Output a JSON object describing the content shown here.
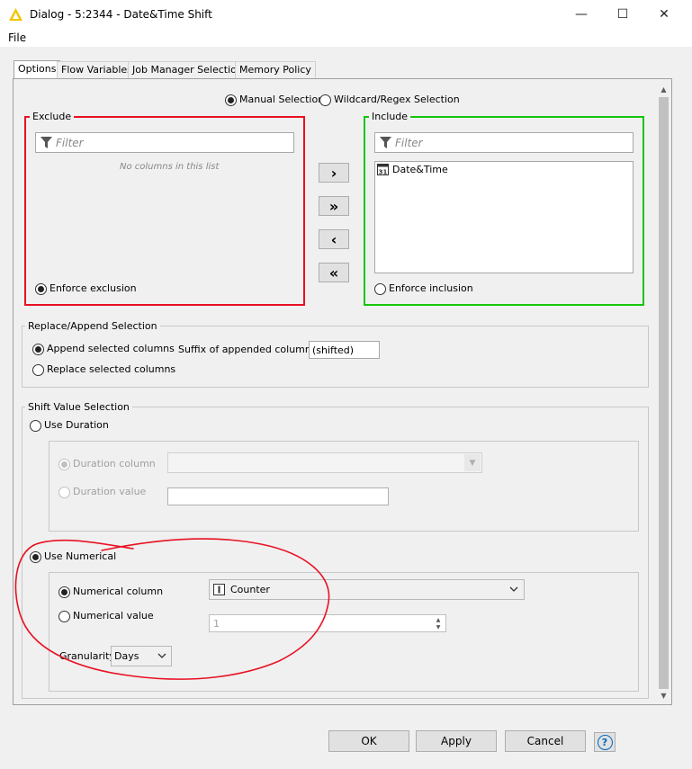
{
  "window": {
    "title": "Dialog - 5:2344 - Date&Time Shift",
    "minimize": "—",
    "maximize": "☐",
    "close": "✕"
  },
  "menu": {
    "file": "File"
  },
  "tabs": [
    "Options",
    "Flow Variables",
    "Job Manager Selection",
    "Memory Policy"
  ],
  "selection_mode": {
    "manual": "Manual Selection",
    "wildcard": "Wildcard/Regex Selection"
  },
  "exclude": {
    "title": "Exclude",
    "filter_placeholder": "Filter",
    "empty_text": "No columns in this list",
    "enforce": "Enforce exclusion"
  },
  "include": {
    "title": "Include",
    "filter_placeholder": "Filter",
    "items": [
      "Date&Time"
    ],
    "enforce": "Enforce inclusion"
  },
  "move_buttons": {
    "add": "›",
    "add_all": "»",
    "remove": "‹",
    "remove_all": "«"
  },
  "replace_append": {
    "title": "Replace/Append Selection",
    "append": "Append selected columns",
    "replace": "Replace selected columns",
    "suffix_label": "Suffix of appended columns:",
    "suffix_value": "(shifted)"
  },
  "shift_value": {
    "title": "Shift Value Selection",
    "use_duration": "Use Duration",
    "duration_column": "Duration column",
    "duration_value": "Duration value",
    "use_numerical": "Use Numerical",
    "numerical_column": "Numerical column",
    "numerical_column_value": "Counter",
    "numerical_value": "Numerical value",
    "numerical_value_input": "1",
    "granularity_label": "Granularity",
    "granularity_value": "Days"
  },
  "buttons": {
    "ok": "OK",
    "apply": "Apply",
    "cancel": "Cancel",
    "help": "?"
  },
  "colors": {
    "exclude_border": "#e81123",
    "include_border": "#16c60c",
    "annotation": "#e81123",
    "help_blue": "#0067c0"
  }
}
